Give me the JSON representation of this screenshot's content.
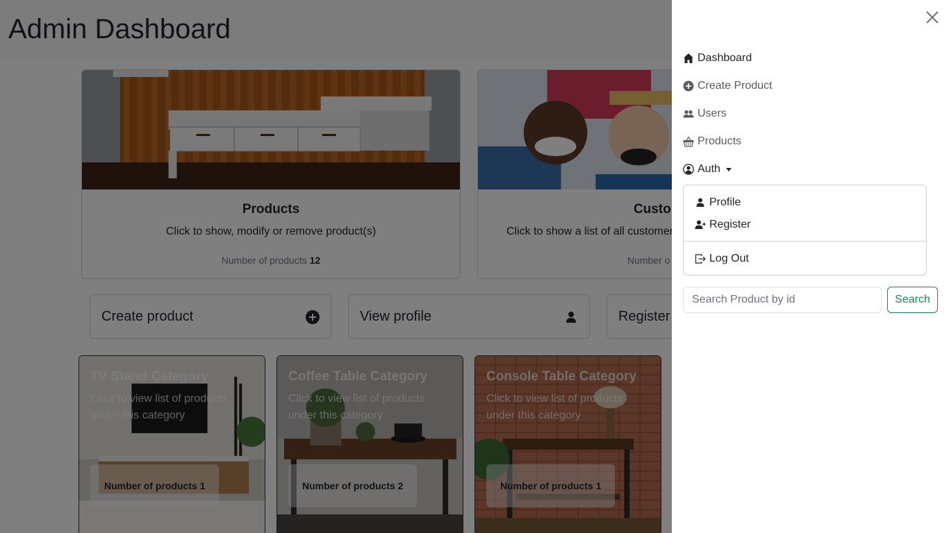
{
  "page": {
    "title": "Admin Dashboard"
  },
  "summary_cards": [
    {
      "title": "Products",
      "text": "Click to show, modify or remove product(s)",
      "count_label": "Number of products",
      "count": "12"
    },
    {
      "title": "Custo",
      "text": "Click to show a list of all customer",
      "count_label": "Number o",
      "count": ""
    }
  ],
  "actions": [
    {
      "label": "Create product",
      "icon": "plus-circle-icon"
    },
    {
      "label": "View profile",
      "icon": "person-icon"
    },
    {
      "label": "Register",
      "icon": "person-plus-icon"
    }
  ],
  "categories": [
    {
      "title": "TV Stand Category",
      "text": "Click to view list of products under this category",
      "count_label": "Number of products 1"
    },
    {
      "title": "Coffee Table Category",
      "text": "Click to view list of products under this category",
      "count_label": "Number of products 2"
    },
    {
      "title": "Console Table Category",
      "text": "Click to view list of products under this category",
      "count_label": "Number of products 1"
    }
  ],
  "offcanvas": {
    "nav": [
      {
        "label": "Dashboard",
        "icon": "house-icon",
        "active": true
      },
      {
        "label": "Create Product",
        "icon": "plus-circle-icon"
      },
      {
        "label": "Users",
        "icon": "people-icon"
      },
      {
        "label": "Products",
        "icon": "basket-icon"
      },
      {
        "label": "Auth",
        "icon": "person-circle-icon"
      }
    ],
    "auth_menu": [
      {
        "label": "Profile",
        "icon": "person-icon"
      },
      {
        "label": "Register",
        "icon": "person-plus-icon"
      },
      {
        "label": "Log Out",
        "icon": "box-arrow-right-icon"
      }
    ],
    "search": {
      "placeholder": "Search Product by id",
      "value": "",
      "button": "Search"
    }
  },
  "colors": {
    "success": "#198754",
    "backdrop": "rgba(0,0,0,0.5)"
  }
}
